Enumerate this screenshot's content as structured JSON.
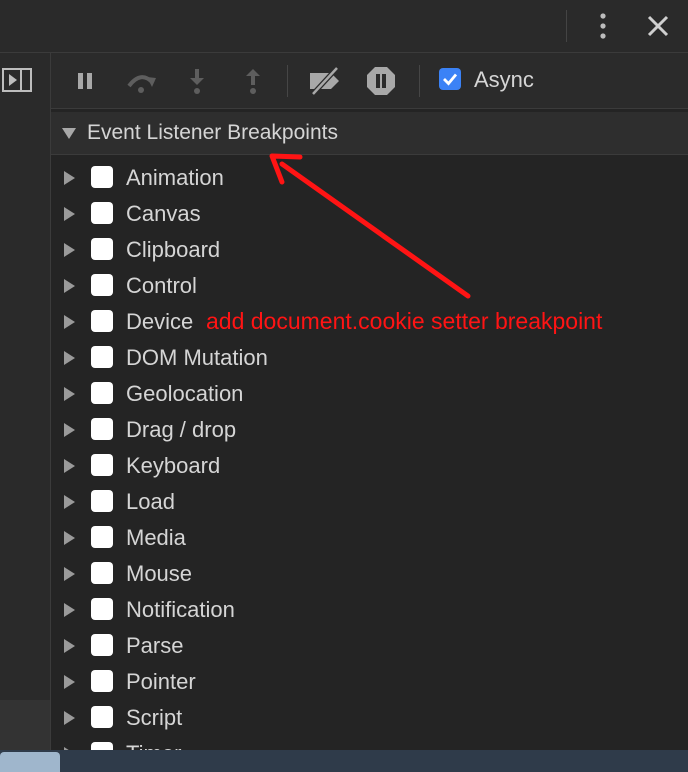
{
  "toolbar": {
    "async_label": "Async",
    "async_checked": true,
    "buttons": [
      "pause-icon",
      "step-over-icon",
      "step-into-icon",
      "step-out-icon",
      "deactivate-breakpoints-icon",
      "pause-on-exceptions-icon"
    ]
  },
  "section": {
    "title": "Event Listener Breakpoints",
    "expanded": true
  },
  "categories": [
    {
      "label": "Animation"
    },
    {
      "label": "Canvas"
    },
    {
      "label": "Clipboard"
    },
    {
      "label": "Control"
    },
    {
      "label": "Device"
    },
    {
      "label": "DOM Mutation"
    },
    {
      "label": "Geolocation"
    },
    {
      "label": "Drag / drop"
    },
    {
      "label": "Keyboard"
    },
    {
      "label": "Load"
    },
    {
      "label": "Media"
    },
    {
      "label": "Mouse"
    },
    {
      "label": "Notification"
    },
    {
      "label": "Parse"
    },
    {
      "label": "Pointer"
    },
    {
      "label": "Script"
    },
    {
      "label": "Timer"
    }
  ],
  "annotation": {
    "text": "add document.cookie setter breakpoint",
    "color": "#ff1414"
  },
  "colors": {
    "background": "#242424",
    "accent": "#3b82f6",
    "text": "#d5d5d5"
  }
}
